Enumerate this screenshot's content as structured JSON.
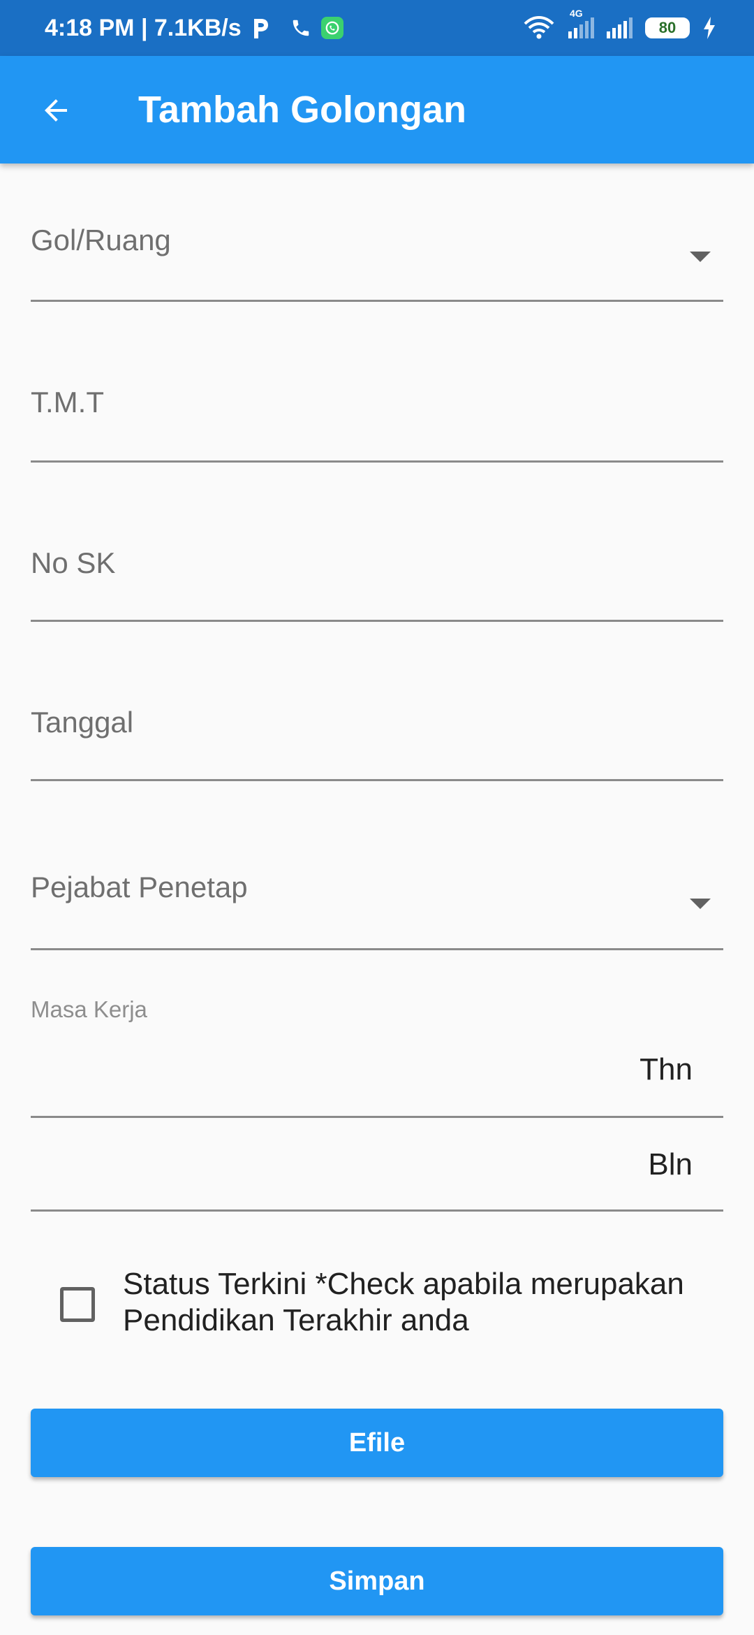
{
  "status_bar": {
    "time_speed": "4:18 PM | 7.1KB/s",
    "network_type": "4G",
    "battery": "80"
  },
  "app_bar": {
    "title": "Tambah Golongan",
    "back_icon": "arrow-back-icon"
  },
  "form": {
    "gol_ruang": {
      "label": "Gol/Ruang",
      "value": ""
    },
    "tmt": {
      "label": "T.M.T",
      "value": ""
    },
    "no_sk": {
      "label": "No SK",
      "value": ""
    },
    "tanggal": {
      "label": "Tanggal",
      "value": ""
    },
    "pejabat_penetap": {
      "label": "Pejabat Penetap",
      "value": ""
    },
    "masa_kerja": {
      "label": "Masa Kerja",
      "tahun_suffix": "Thn",
      "bulan_suffix": "Bln"
    },
    "status_terkini": {
      "label": "Status Terkini *Check apabila merupakan Pendidikan Terakhir anda",
      "checked": false
    }
  },
  "buttons": {
    "efile": "Efile",
    "simpan": "Simpan"
  },
  "colors": {
    "primary": "#2196f3",
    "status_bar": "#1a6fc4",
    "background": "#fafafa"
  }
}
